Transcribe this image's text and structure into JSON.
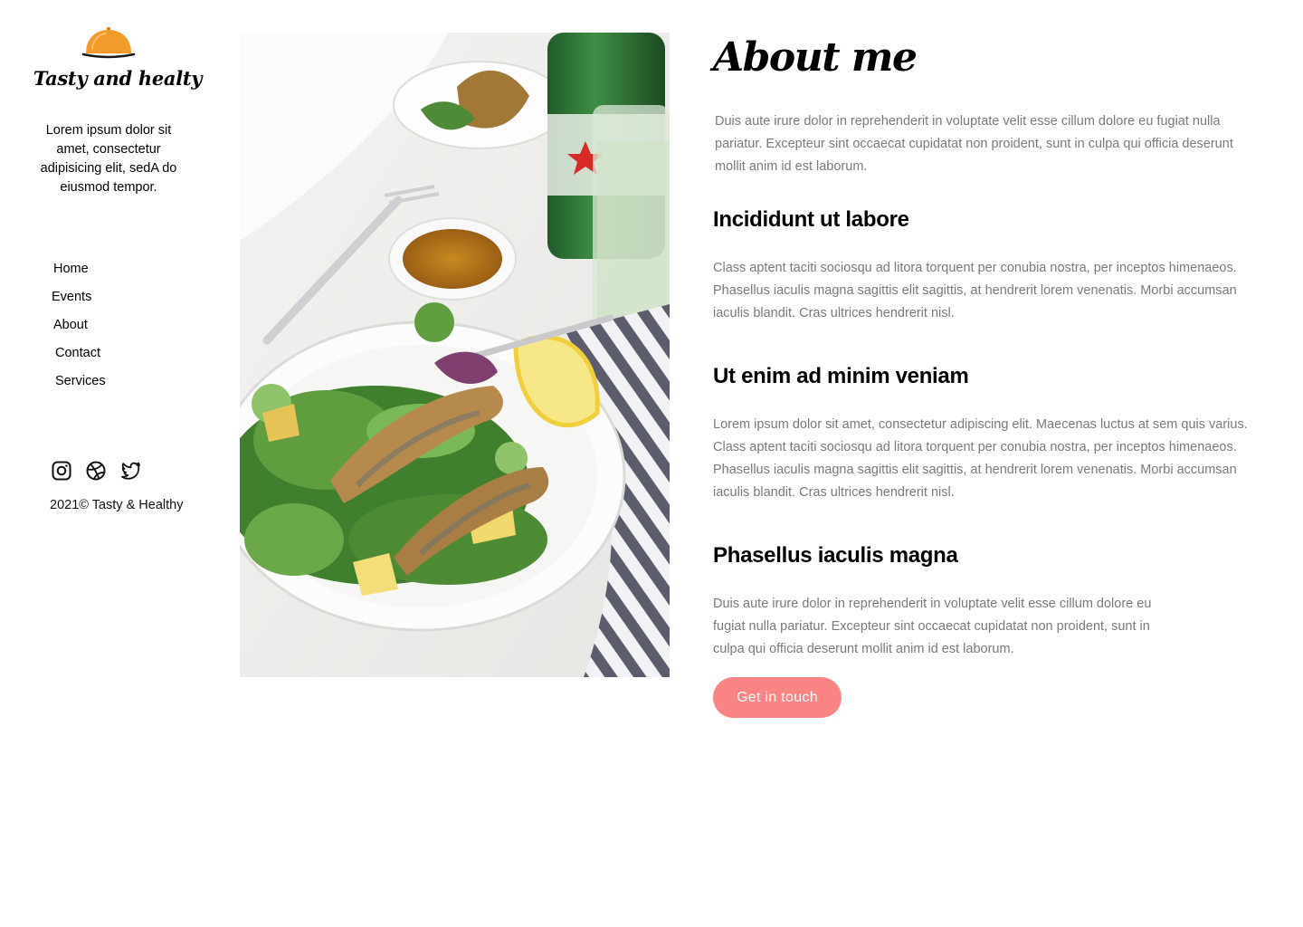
{
  "brand": {
    "name": "Tasty and healty",
    "logo_icon": "food-cloche-icon",
    "tagline": "Lorem ipsum dolor sit amet, consectetur adipisicing elit, sedA do eiusmod tempor."
  },
  "nav": {
    "items": [
      {
        "label": "Home"
      },
      {
        "label": "Events"
      },
      {
        "label": "About"
      },
      {
        "label": "Contact"
      },
      {
        "label": "Services"
      }
    ]
  },
  "socials": [
    {
      "icon": "instagram-icon"
    },
    {
      "icon": "dribbble-icon"
    },
    {
      "icon": "twitter-icon"
    }
  ],
  "footer": {
    "copyright": "2021© Tasty & Healthy"
  },
  "photo": {
    "subject": "salad-plate-photo"
  },
  "content": {
    "title": "About me",
    "intro": "Duis aute irure dolor in reprehenderit in voluptate velit esse cillum dolore eu fugiat nulla pariatur. Excepteur sint occaecat cupidatat non proident, sunt in culpa qui officia deserunt mollit anim id est laborum.",
    "sections": [
      {
        "title": "Incididunt ut labore",
        "body": "Class aptent taciti sociosqu ad litora torquent per conubia nostra, per inceptos himenaeos. Phasellus iaculis magna sagittis elit sagittis, at hendrerit lorem venenatis. Morbi accumsan iaculis blandit. Cras ultrices hendrerit nisl."
      },
      {
        "title": "Ut enim ad minim veniam",
        "body": "Lorem ipsum dolor sit amet, consectetur adipiscing elit. Maecenas luctus at sem quis varius. Class aptent taciti sociosqu ad litora torquent per conubia nostra, per inceptos himenaeos. Phasellus iaculis magna sagittis elit sagittis, at hendrerit lorem venenatis. Morbi accumsan iaculis blandit. Cras ultrices hendrerit nisl."
      },
      {
        "title": "Phasellus iaculis magna",
        "body": "Duis aute irure dolor in reprehenderit in voluptate velit esse cillum dolore eu fugiat nulla pariatur. Excepteur sint occaecat cupidatat non proident, sunt in culpa qui officia deserunt mollit anim id est laborum."
      }
    ],
    "cta_label": "Get in touch"
  },
  "colors": {
    "accent": "#fa8383",
    "logo": "#f39a2c",
    "body_text": "#7a7a7a",
    "heading": "#000000"
  }
}
